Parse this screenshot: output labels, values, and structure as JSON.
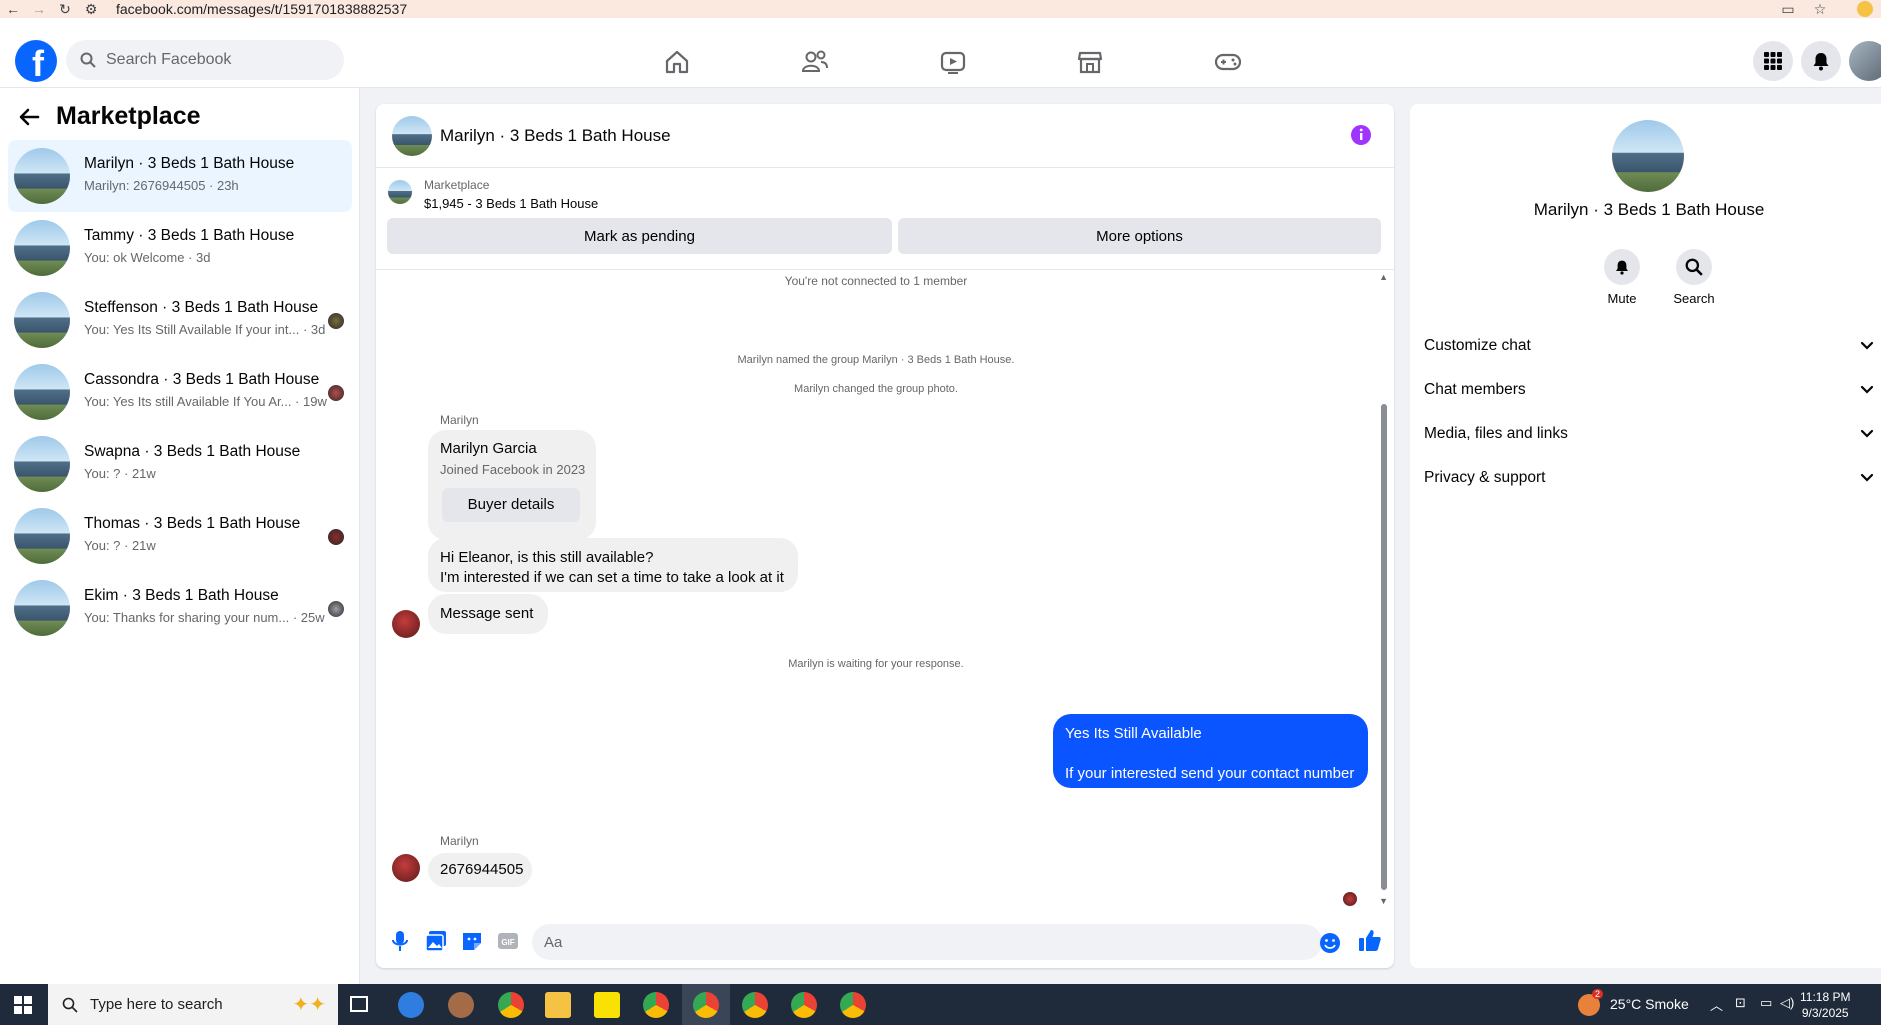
{
  "browser": {
    "url": "facebook.com/messages/t/1591701838882537"
  },
  "header": {
    "logo_letter": "f",
    "search_placeholder": "Search Facebook"
  },
  "sidebar": {
    "title": "Marketplace",
    "conversations": [
      {
        "title": "Marilyn · 3 Beds 1 Bath House",
        "snippet": "Marilyn: 2676944505 · 23h",
        "active": true
      },
      {
        "title": "Tammy · 3 Beds 1 Bath House",
        "snippet": "You: ok Welcome · 3d"
      },
      {
        "title": "Steffenson · 3 Beds 1 Bath House",
        "snippet": "You: Yes Its Still Available If your int... · 3d"
      },
      {
        "title": "Cassondra · 3 Beds 1 Bath House",
        "snippet": "You: Yes Its still Available If You Ar... · 19w"
      },
      {
        "title": "Swapna · 3 Beds 1 Bath House",
        "snippet": "You: ? · 21w"
      },
      {
        "title": "Thomas · 3 Beds 1 Bath House",
        "snippet": "You: ? · 21w"
      },
      {
        "title": "Ekim · 3 Beds 1 Bath House",
        "snippet": "You: Thanks for sharing your num... · 25w"
      }
    ]
  },
  "chat": {
    "title": "Marilyn · 3 Beds 1 Bath House",
    "listing": {
      "source": "Marketplace",
      "detail": "$1,945 - 3 Beds 1 Bath House",
      "pending_label": "Mark as pending",
      "more_label": "More options"
    },
    "system": {
      "not_connected": "You're not connected to 1 member",
      "named": "Marilyn named the group Marilyn · 3 Beds 1 Bath House.",
      "photo": "Marilyn changed the group photo.",
      "waiting": "Marilyn is waiting for your response."
    },
    "sender_name": "Marilyn",
    "profile_card": {
      "name": "Marilyn Garcia",
      "joined": "Joined Facebook in 2023",
      "button": "Buyer details"
    },
    "msg_hi_1": "Hi Eleanor, is this still available?",
    "msg_hi_2": "I'm interested if we can set a time to take a look at it",
    "msg_sent": "Message sent",
    "reply_1": "Yes Its Still Available",
    "reply_2": "If your interested send your contact number",
    "msg_number": "2676944505",
    "composer_placeholder": "Aa"
  },
  "rpanel": {
    "title": "Marilyn · 3 Beds 1 Bath House",
    "mute": "Mute",
    "search": "Search",
    "rows": [
      "Customize chat",
      "Chat members",
      "Media, files and links",
      "Privacy & support"
    ]
  },
  "taskbar": {
    "search_placeholder": "Type here to search",
    "weather": "25°C  Smoke",
    "time": "11:18 PM",
    "date": "9/3/2025",
    "weather_badge": "2"
  },
  "colors": {
    "brand": "#0866ff",
    "my_bubble": "#0a55ff",
    "info": "#a033ff"
  }
}
